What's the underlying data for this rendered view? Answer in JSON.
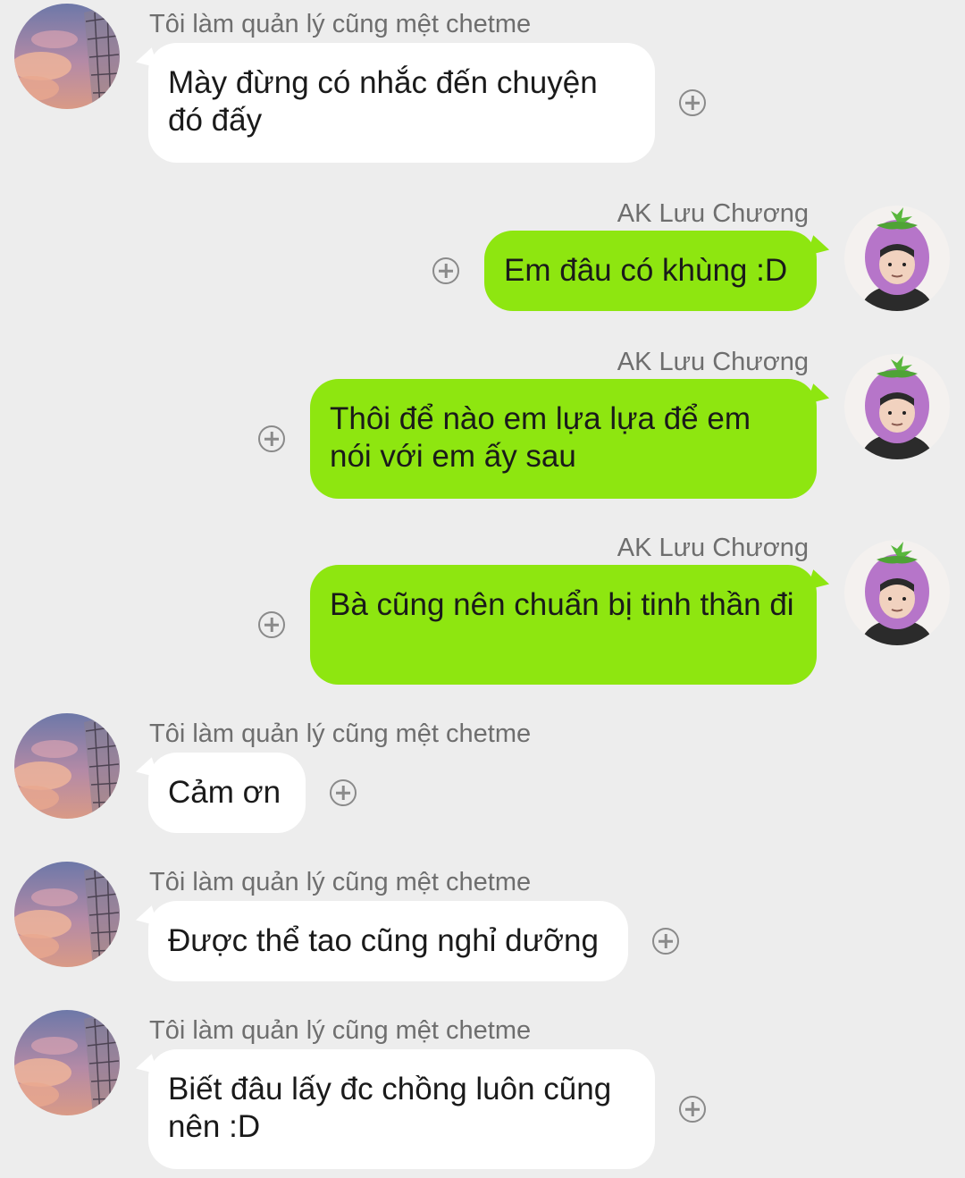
{
  "contacts": {
    "other": {
      "name": "Tôi làm quản lý cũng mệt chetme",
      "avatar_icon": "sunset-building-avatar-icon"
    },
    "me": {
      "name": "AK Lưu Chương",
      "avatar_icon": "eggplant-hat-avatar-icon"
    }
  },
  "messages": [
    {
      "direction": "in",
      "sender": "Tôi làm quản lý cũng mệt chetme",
      "text": "Mày đừng có nhắc đến chuyện đó đấy"
    },
    {
      "direction": "out",
      "sender": "AK Lưu Chương",
      "text": "Em đâu có khùng :D"
    },
    {
      "direction": "out",
      "sender": "AK Lưu Chương",
      "text": "Thôi để nào em lựa lựa để em nói với em ấy sau"
    },
    {
      "direction": "out",
      "sender": "AK Lưu Chương",
      "text": "Bà cũng nên chuẩn bị tinh thần đi"
    },
    {
      "direction": "in",
      "sender": "Tôi làm quản lý cũng mệt chetme",
      "text": "Cảm ơn"
    },
    {
      "direction": "in",
      "sender": "Tôi làm quản lý cũng mệt chetme",
      "text": "Được thể tao cũng nghỉ dưỡng"
    },
    {
      "direction": "in",
      "sender": "Tôi làm quản lý cũng mệt chetme",
      "text": "Biết đâu lấy đc chồng luôn cũng nên :D"
    }
  ],
  "colors": {
    "background": "#ededed",
    "incoming_bubble": "#ffffff",
    "outgoing_bubble": "#8ee610",
    "sender_name": "#6e6e6e",
    "text": "#1a1a1a"
  },
  "icons": {
    "react": "add-reaction-icon"
  }
}
